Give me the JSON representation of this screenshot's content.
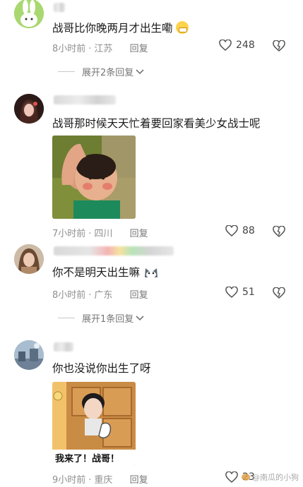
{
  "comments": [
    {
      "text": "战哥比你晚两月才出生嘞",
      "emoji": "grin-emoji",
      "time": "8小时前",
      "location": "江苏",
      "reply_label": "回复",
      "likes": "248",
      "expand_label": "展开2条回复"
    },
    {
      "text": "战哥那时候天天忙着要回家看美少女战士呢",
      "time": "7小时前",
      "location": "四川",
      "reply_label": "回复",
      "likes": "88"
    },
    {
      "text": "你不是明天出生嘛",
      "emoji": "cat-emoji",
      "time": "8小时前",
      "location": "广东",
      "reply_label": "回复",
      "likes": "51",
      "expand_label": "展开1条回复"
    },
    {
      "text": "你也没说你出生了呀",
      "sticker_caption": "我来了！战哥！",
      "time": "9小时前",
      "location": "重庆",
      "reply_label": "回复",
      "likes": "23"
    }
  ],
  "watermark": "@南瓜的小狗",
  "icons": {
    "like": "heart-outline-icon",
    "dislike": "broken-heart-icon",
    "expand": "chevron-down-icon"
  }
}
